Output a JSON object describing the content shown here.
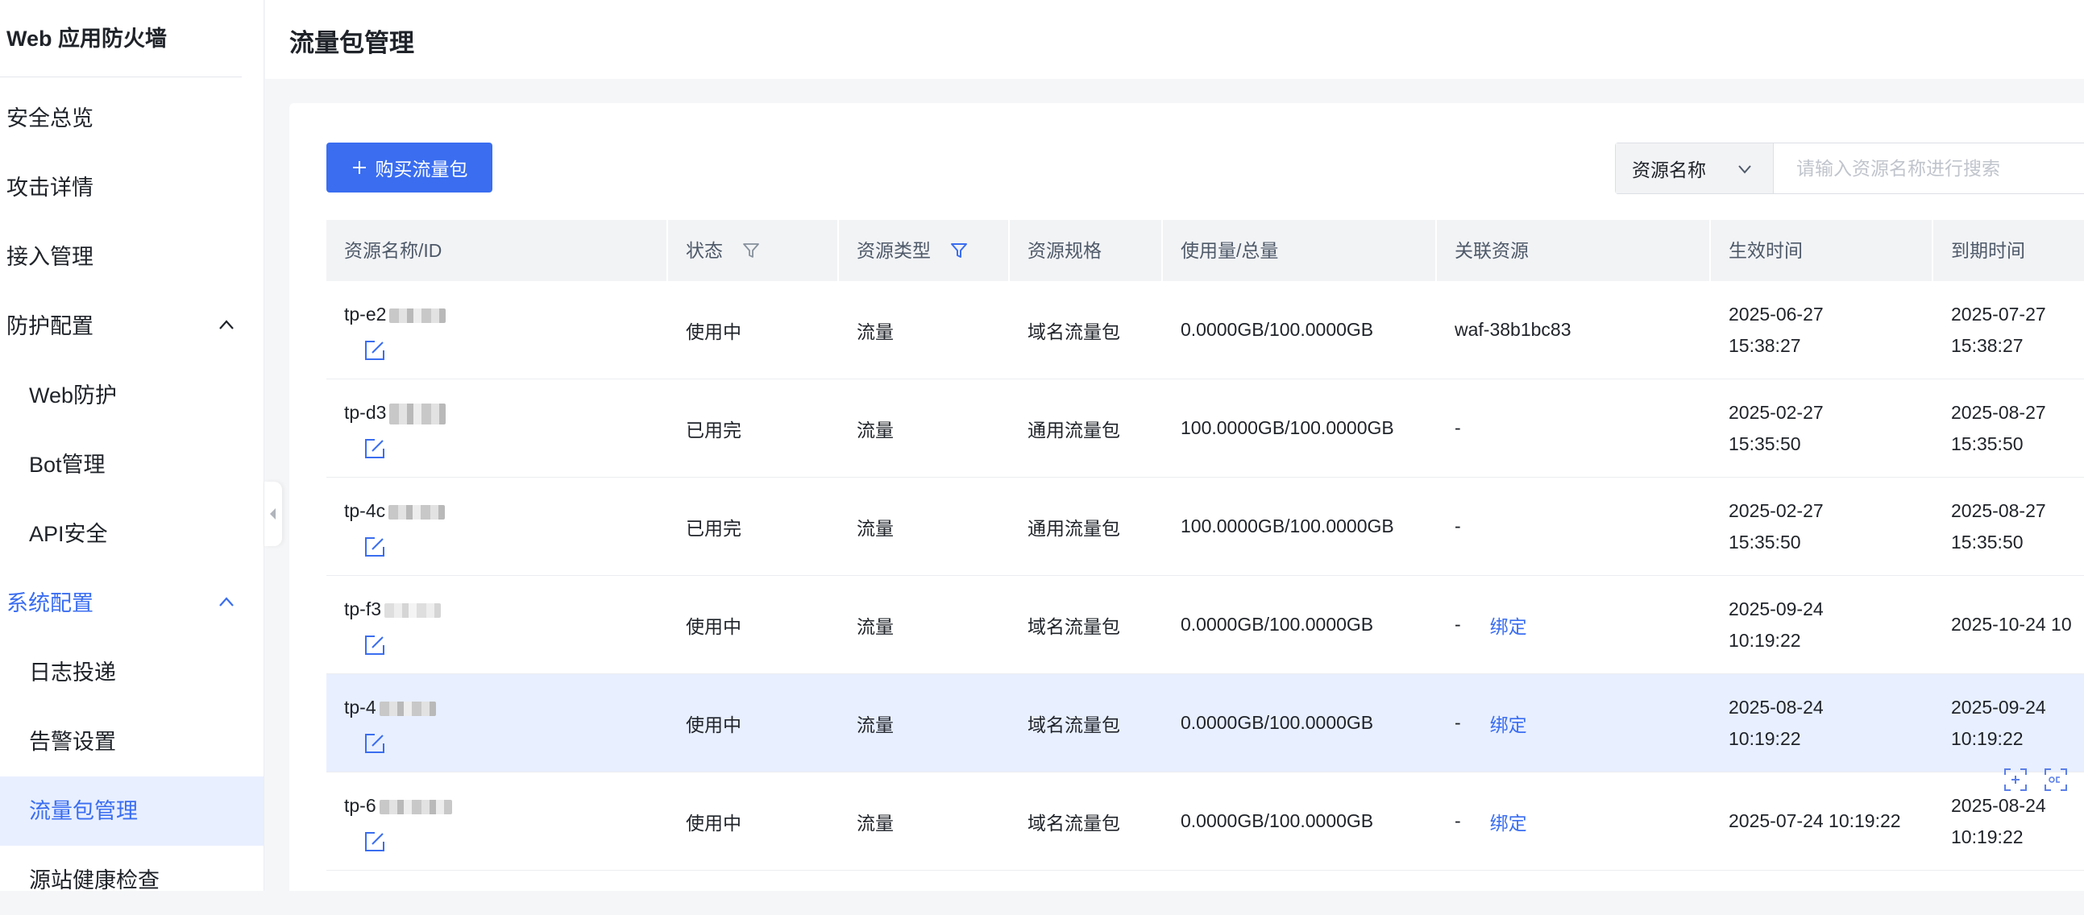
{
  "app": {
    "title": "Web 应用防火墙"
  },
  "sidebar": {
    "items": [
      {
        "label": "安全总览"
      },
      {
        "label": "攻击详情"
      },
      {
        "label": "接入管理"
      },
      {
        "label": "防护配置"
      },
      {
        "label": "Web防护"
      },
      {
        "label": "Bot管理"
      },
      {
        "label": "API安全"
      },
      {
        "label": "系统配置"
      },
      {
        "label": "日志投递"
      },
      {
        "label": "告警设置"
      },
      {
        "label": "流量包管理"
      },
      {
        "label": "源站健康检查"
      }
    ]
  },
  "page": {
    "title": "流量包管理"
  },
  "toolbar": {
    "buy_label": "购买流量包",
    "plus_icon": "plus-icon"
  },
  "search": {
    "field": "资源名称",
    "placeholder": "请输入资源名称进行搜索"
  },
  "table": {
    "headers": {
      "name": "资源名称/ID",
      "status": "状态",
      "type": "资源类型",
      "spec": "资源规格",
      "usage": "使用量/总量",
      "resource": "关联资源",
      "start": "生效时间",
      "end": "到期时间"
    },
    "bind_label": "绑定",
    "rows": [
      {
        "name": "tp-e2",
        "status": "使用中",
        "type": "流量",
        "spec": "域名流量包",
        "usage": "0.0000GB/100.0000GB",
        "resource": "waf-38b1bc83",
        "start_date": "2025-06-27",
        "start_time": "15:38:27",
        "end_date": "2025-07-27",
        "end_time": "15:38:27"
      },
      {
        "name": "tp-d3",
        "status": "已用完",
        "type": "流量",
        "spec": "通用流量包",
        "usage": "100.0000GB/100.0000GB",
        "resource": "-",
        "start_date": "2025-02-27",
        "start_time": "15:35:50",
        "end_date": "2025-08-27",
        "end_time": "15:35:50"
      },
      {
        "name": "tp-4c",
        "status": "已用完",
        "type": "流量",
        "spec": "通用流量包",
        "usage": "100.0000GB/100.0000GB",
        "resource": "-",
        "start_date": "2025-02-27",
        "start_time": "15:35:50",
        "end_date": "2025-08-27",
        "end_time": "15:35:50"
      },
      {
        "name": "tp-f3",
        "status": "使用中",
        "type": "流量",
        "spec": "域名流量包",
        "usage": "0.0000GB/100.0000GB",
        "resource": "-",
        "start_date": "2025-09-24",
        "start_time": "10:19:22",
        "end_date": "2025-10-24 10",
        "end_time": ""
      },
      {
        "name": "tp-4",
        "status": "使用中",
        "type": "流量",
        "spec": "域名流量包",
        "usage": "0.0000GB/100.0000GB",
        "resource": "-",
        "start_date": "2025-08-24",
        "start_time": "10:19:22",
        "end_date": "2025-09-24",
        "end_time": "10:19:22"
      },
      {
        "name": "tp-6",
        "status": "使用中",
        "type": "流量",
        "spec": "域名流量包",
        "usage": "0.0000GB/100.0000GB",
        "resource": "-",
        "start_date": "2025-07-24 10:19:22",
        "start_time": "",
        "end_date": "2025-08-24",
        "end_time": "10:19:22"
      }
    ]
  },
  "colors": {
    "accent": "#3a6df0",
    "active_bg": "#e8efff"
  }
}
